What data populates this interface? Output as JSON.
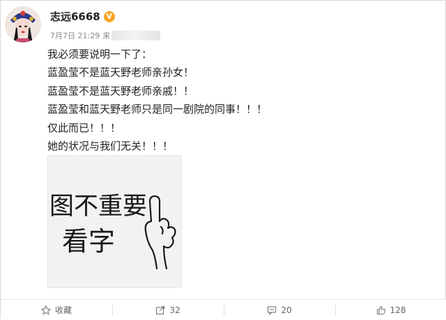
{
  "post": {
    "username": "志远6668",
    "verified_badge": "V",
    "date": "7月7日 21:29",
    "source_prefix": "来",
    "lines": [
      "我必须要说明一下了：",
      "蓝盈莹不是蓝天野老师亲孙女！",
      "蓝盈莹不是蓝天野老师亲戚！！",
      "蓝盈莹和蓝天野老师只是同一剧院的同事！！！",
      "仅此而已！！！",
      "她的状况与我们无关！！！"
    ],
    "image": {
      "line1": "图不重要",
      "line2": "看字"
    }
  },
  "actions": {
    "favorite": {
      "label": "收藏",
      "icon": "star-icon"
    },
    "repost": {
      "label": "32",
      "icon": "share-icon"
    },
    "comment": {
      "label": "20",
      "icon": "comment-icon"
    },
    "like": {
      "label": "128",
      "icon": "thumbs-up-icon"
    }
  },
  "colors": {
    "badge": "#f5a623",
    "text": "#222222",
    "muted": "#888888"
  }
}
